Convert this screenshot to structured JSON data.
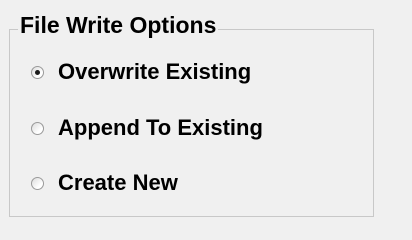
{
  "group": {
    "title": "File Write Options"
  },
  "options": [
    {
      "label": "Overwrite Existing",
      "selected": true
    },
    {
      "label": "Append To Existing",
      "selected": false
    },
    {
      "label": "Create New",
      "selected": false
    }
  ]
}
